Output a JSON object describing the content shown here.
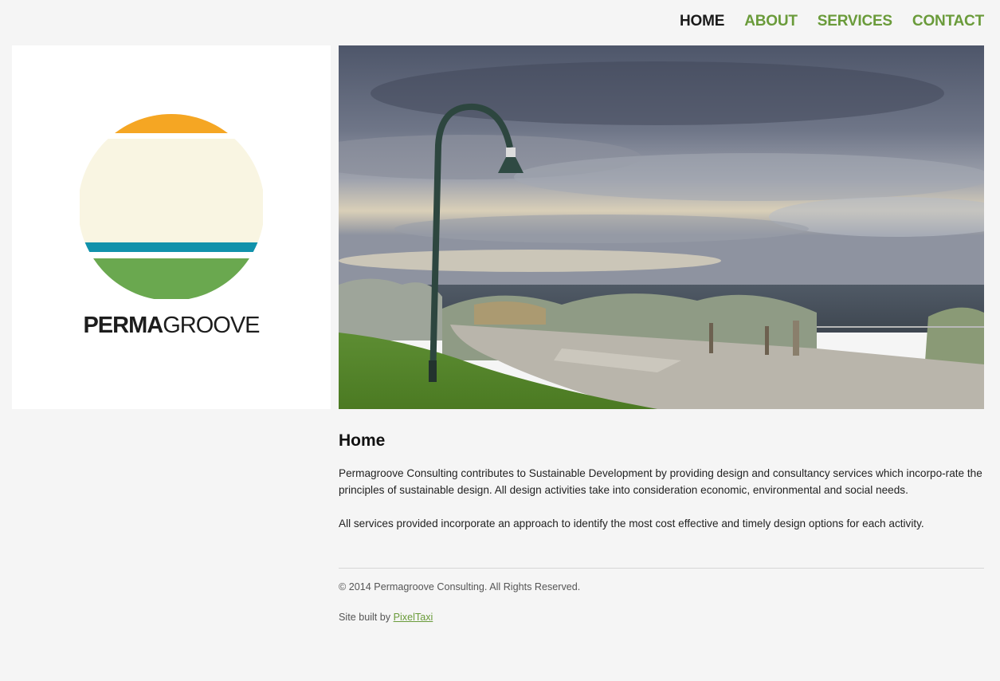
{
  "nav": {
    "items": [
      {
        "label": "HOME",
        "active": true
      },
      {
        "label": "ABOUT",
        "active": false
      },
      {
        "label": "SERVICES",
        "active": false
      },
      {
        "label": "CONTACT",
        "active": false
      }
    ]
  },
  "logo": {
    "text_bold": "PERMA",
    "text_light": "GROOVE",
    "colors": {
      "sun": "#f5a623",
      "sky": "#f9f5e2",
      "water": "#1192ab",
      "land": "#6aa84f"
    }
  },
  "hero": {
    "icon": "seaside-lamp-post-photo"
  },
  "main": {
    "heading": "Home",
    "paragraph1": "Permagroove Consulting contributes to Sustainable Development by providing design and consultancy services which incorpo-rate the principles of sustainable design.  All design activities take into consideration economic, environmental and social needs.",
    "paragraph2": "All services provided incorporate an approach to identify the most cost effective and timely design options for each activity."
  },
  "footer": {
    "copyright": "© 2014 Permagroove Consulting. All Rights Reserved.",
    "built_by_prefix": "Site built by ",
    "built_by_link": "PixelTaxi"
  },
  "colors": {
    "accent": "#6a9b3a",
    "background": "#f5f5f5"
  }
}
